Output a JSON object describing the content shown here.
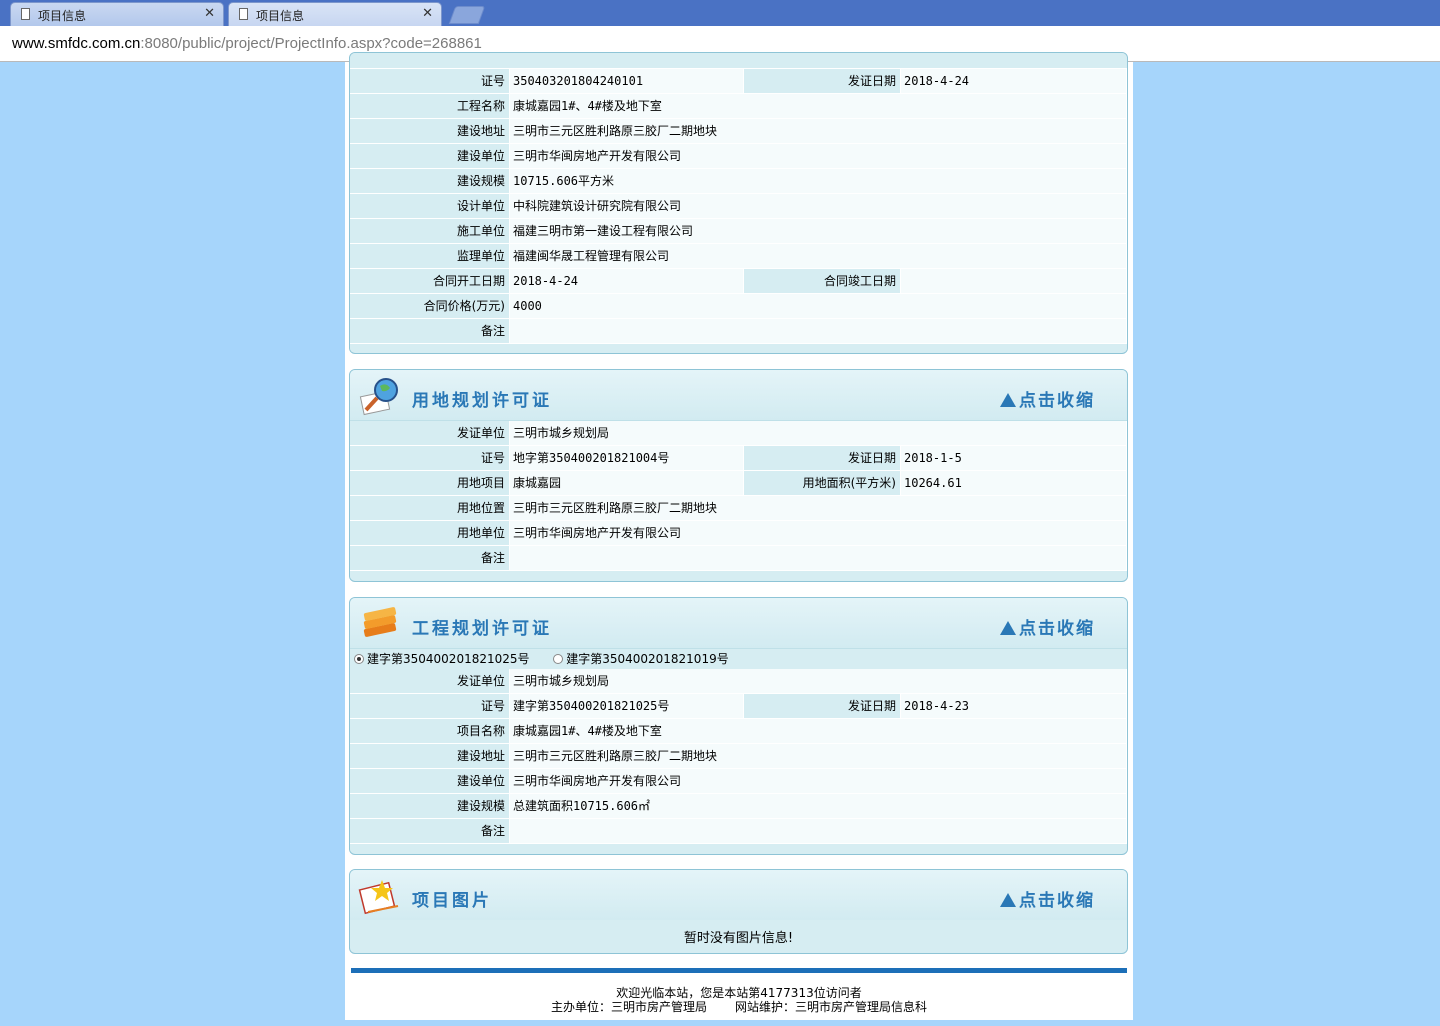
{
  "browser": {
    "tabs": [
      {
        "title": "项目信息"
      },
      {
        "title": "项目信息"
      }
    ],
    "url_host": "www.smfdc.com.cn",
    "url_path": ":8080/public/project/ProjectInfo.aspx?code=268861"
  },
  "construction_permit": {
    "rows": [
      {
        "type": "pair",
        "l1": "证号",
        "v1": "350403201804240101",
        "l2": "发证日期",
        "v2": "2018-4-24"
      },
      {
        "type": "single",
        "l": "工程名称",
        "v": "康城嘉园1#、4#楼及地下室"
      },
      {
        "type": "single",
        "l": "建设地址",
        "v": "三明市三元区胜利路原三胶厂二期地块"
      },
      {
        "type": "single",
        "l": "建设单位",
        "v": "三明市华闽房地产开发有限公司"
      },
      {
        "type": "single",
        "l": "建设规模",
        "v": "10715.606平方米"
      },
      {
        "type": "single",
        "l": "设计单位",
        "v": "中科院建筑设计研究院有限公司"
      },
      {
        "type": "single",
        "l": "施工单位",
        "v": "福建三明市第一建设工程有限公司"
      },
      {
        "type": "single",
        "l": "监理单位",
        "v": "福建闽华晟工程管理有限公司"
      },
      {
        "type": "pair",
        "l1": "合同开工日期",
        "v1": "2018-4-24",
        "l2": "合同竣工日期",
        "v2": ""
      },
      {
        "type": "single",
        "l": "合同价格(万元)",
        "v": "4000"
      },
      {
        "type": "single",
        "l": "备注",
        "v": ""
      }
    ]
  },
  "land_permit": {
    "title": "用地规划许可证",
    "collapse_label": "点击收缩",
    "rows": [
      {
        "type": "single",
        "l": "发证单位",
        "v": "三明市城乡规划局"
      },
      {
        "type": "pair",
        "l1": "证号",
        "v1": "地字第350400201821004号",
        "l2": "发证日期",
        "v2": "2018-1-5"
      },
      {
        "type": "pair",
        "l1": "用地项目",
        "v1": "康城嘉园",
        "l2": "用地面积(平方米)",
        "v2": "10264.61"
      },
      {
        "type": "single",
        "l": "用地位置",
        "v": "三明市三元区胜利路原三胶厂二期地块"
      },
      {
        "type": "single",
        "l": "用地单位",
        "v": "三明市华闽房地产开发有限公司"
      },
      {
        "type": "single",
        "l": "备注",
        "v": ""
      }
    ]
  },
  "project_permit": {
    "title": "工程规划许可证",
    "collapse_label": "点击收缩",
    "options": [
      {
        "label": "建字第350400201821025号",
        "selected": true
      },
      {
        "label": "建字第350400201821019号",
        "selected": false
      }
    ],
    "rows": [
      {
        "type": "single",
        "l": "发证单位",
        "v": "三明市城乡规划局"
      },
      {
        "type": "pair",
        "l1": "证号",
        "v1": "建字第350400201821025号",
        "l2": "发证日期",
        "v2": "2018-4-23"
      },
      {
        "type": "single",
        "l": "项目名称",
        "v": "康城嘉园1#、4#楼及地下室"
      },
      {
        "type": "single",
        "l": "建设地址",
        "v": "三明市三元区胜利路原三胶厂二期地块"
      },
      {
        "type": "single",
        "l": "建设单位",
        "v": "三明市华闽房地产开发有限公司"
      },
      {
        "type": "single",
        "l": "建设规模",
        "v": "总建筑面积10715.606㎡"
      },
      {
        "type": "single",
        "l": "备注",
        "v": ""
      }
    ]
  },
  "pictures": {
    "title": "项目图片",
    "collapse_label": "点击收缩",
    "empty_text": "暂时没有图片信息!"
  },
  "footer": {
    "line1": "欢迎光临本站，您是本站第4177313位访问者",
    "host": "主办单位：三明市房产管理局",
    "maint": "网站维护：三明市房产管理局信息科"
  },
  "icons": {
    "land": "magnifier-globe-icon",
    "project": "books-icon",
    "pictures": "picture-star-icon"
  }
}
